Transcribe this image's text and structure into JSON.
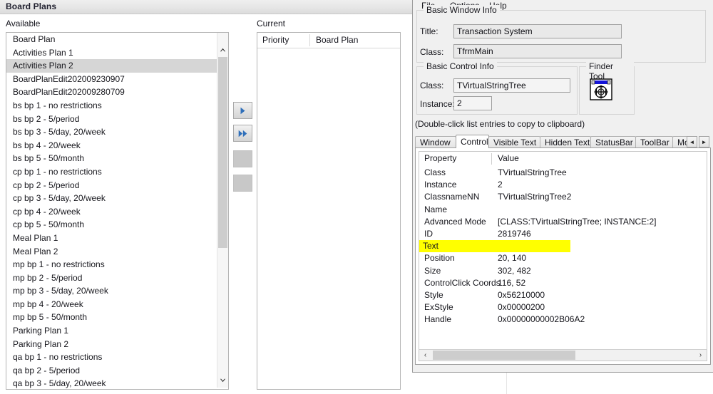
{
  "background_app": {
    "title": "Board Plans",
    "available_label": "Available",
    "current_label": "Current",
    "available_items": [
      "Board Plan",
      "Activities Plan 1",
      "Activities Plan 2",
      "BoardPlanEdit202009230907",
      "BoardPlanEdit202009280709",
      "bs bp 1 - no restrictions",
      "bs bp 2 - 5/period",
      "bs bp 3 - 5/day, 20/week",
      "bs bp 4 - 20/week",
      "bs bp 5 - 50/month",
      "cp bp 1 - no restrictions",
      "cp bp 2 - 5/period",
      "cp bp 3 - 5/day, 20/week",
      "cp bp 4 - 20/week",
      "cp bp 5 - 50/month",
      "Meal Plan 1",
      "Meal Plan 2",
      "mp bp 1 - no restrictions",
      "mp bp 2 - 5/period",
      "mp bp 3 - 5/day, 20/week",
      "mp bp 4 - 20/week",
      "mp bp 5 - 50/month",
      "Parking Plan 1",
      "Parking Plan 2",
      "qa bp 1 - no restrictions",
      "qa bp 2 - 5/period",
      "qa bp 3 - 5/day, 20/week"
    ],
    "selected_item": "Activities Plan 2",
    "transfer_buttons": [
      {
        "name": "move-right",
        "icon": "single-right-arrow-icon",
        "enabled": true
      },
      {
        "name": "move-all-right",
        "icon": "double-right-arrow-icon",
        "enabled": true
      },
      {
        "name": "move-left",
        "icon": "single-left-arrow-icon",
        "enabled": false
      },
      {
        "name": "move-all-left",
        "icon": "double-left-arrow-icon",
        "enabled": false
      }
    ],
    "current_columns": [
      "Priority",
      "Board Plan"
    ],
    "current_rows": []
  },
  "tool_window": {
    "menu": [
      "File",
      "Options",
      "Help"
    ],
    "basic_window_info": {
      "group_title": "Basic Window Info",
      "title_label": "Title:",
      "title_value": "Transaction System",
      "class_label": "Class:",
      "class_value": "TfrmMain"
    },
    "basic_control_info": {
      "group_title": "Basic Control Info",
      "class_label": "Class:",
      "class_value": "TVirtualStringTree",
      "instance_label": "Instance:",
      "instance_value": "2"
    },
    "finder_tool": {
      "group_title": "Finder Tool",
      "icon": "finder-target-icon"
    },
    "hint": "(Double-click list entries to copy to clipboard)",
    "tabs": [
      {
        "label": "Window",
        "active": false
      },
      {
        "label": "Control",
        "active": true
      },
      {
        "label": "Visible Text",
        "active": false
      },
      {
        "label": "Hidden Text",
        "active": false
      },
      {
        "label": "StatusBar",
        "active": false
      },
      {
        "label": "ToolBar",
        "active": false
      },
      {
        "label": "Mo",
        "active": false
      }
    ],
    "tab_scroll_left": "◄",
    "tab_scroll_right": "►",
    "property_list": {
      "columns": [
        "Property",
        "Value"
      ],
      "rows": [
        {
          "property": "Class",
          "value": "TVirtualStringTree",
          "highlighted": false
        },
        {
          "property": "Instance",
          "value": "2",
          "highlighted": false
        },
        {
          "property": "ClassnameNN",
          "value": "TVirtualStringTree2",
          "highlighted": false
        },
        {
          "property": "Name",
          "value": "",
          "highlighted": false
        },
        {
          "property": "Advanced Mode",
          "value": "[CLASS:TVirtualStringTree; INSTANCE:2]",
          "highlighted": false
        },
        {
          "property": "ID",
          "value": "2819746",
          "highlighted": false
        },
        {
          "property": "Text",
          "value": "",
          "highlighted": true
        },
        {
          "property": "Position",
          "value": "20, 140",
          "highlighted": false
        },
        {
          "property": "Size",
          "value": "302, 482",
          "highlighted": false
        },
        {
          "property": "ControlClick Coords",
          "value": "116, 52",
          "highlighted": false
        },
        {
          "property": "Style",
          "value": "0x56210000",
          "highlighted": false
        },
        {
          "property": "ExStyle",
          "value": "0x00000200",
          "highlighted": false
        },
        {
          "property": "Handle",
          "value": "0x00000000002B06A2",
          "highlighted": false
        }
      ],
      "highlight_color": "#ffff00"
    },
    "hscroll_left_arrow": "‹",
    "hscroll_right_arrow": "›"
  }
}
